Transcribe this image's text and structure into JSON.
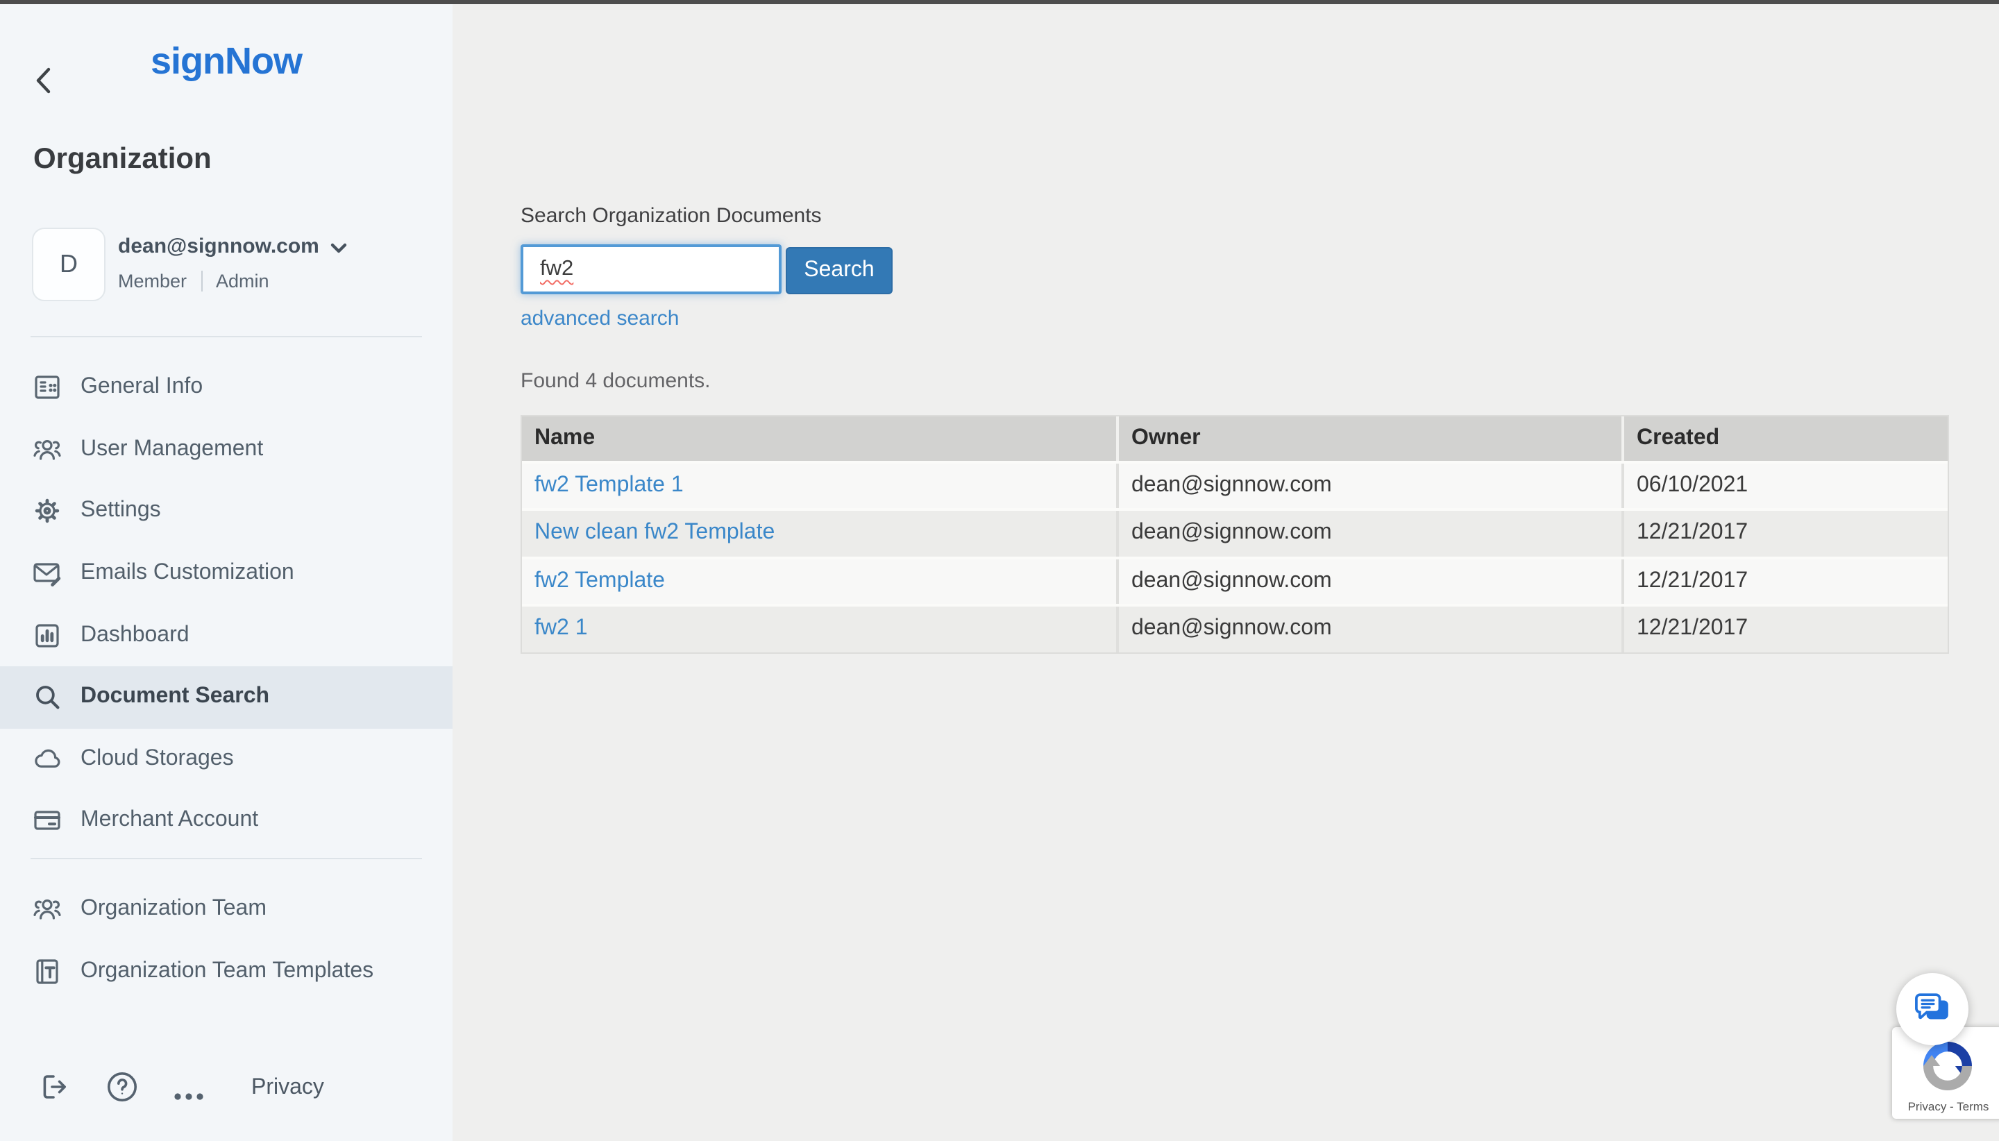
{
  "colors": {
    "accent_blue": "#2574d4",
    "link_blue": "#3a87c9",
    "button_blue": "#3379b5",
    "sidebar_bg": "#f3f6f9",
    "main_bg": "#efefee",
    "active_item_bg": "#e2e8ee",
    "slate_icon": "#5a6671",
    "table_header_bg": "#d2d2d0",
    "row_light": "#f8f8f7",
    "row_dark": "#ececea",
    "topbar": "#4d4d4d",
    "spellcheck_red": "#f26b63"
  },
  "sidebar": {
    "logo": "signNow",
    "back_icon": "chevron-left-icon",
    "section_title": "Organization",
    "profile": {
      "avatar_letter": "D",
      "email": "dean@signnow.com",
      "dropdown_icon": "chevron-down-icon",
      "roles": [
        "Member",
        "Admin"
      ]
    },
    "nav_primary": [
      {
        "label": "General Info",
        "icon": "building-icon",
        "active": false
      },
      {
        "label": "User Management",
        "icon": "users-icon",
        "active": false
      },
      {
        "label": "Settings",
        "icon": "gear-icon",
        "active": false
      },
      {
        "label": "Emails Customization",
        "icon": "envelope-brush-icon",
        "active": false
      },
      {
        "label": "Dashboard",
        "icon": "bar-chart-icon",
        "active": false
      },
      {
        "label": "Document Search",
        "icon": "search-icon",
        "active": true
      },
      {
        "label": "Cloud Storages",
        "icon": "cloud-icon",
        "active": false
      },
      {
        "label": "Merchant Account",
        "icon": "credit-card-icon",
        "active": false
      }
    ],
    "nav_secondary": [
      {
        "label": "Organization Team",
        "icon": "users-icon",
        "active": false
      },
      {
        "label": "Organization Team Templates",
        "icon": "template-icon",
        "active": false
      }
    ],
    "footer": {
      "logout_icon": "logout-icon",
      "help_icon": "question-circle-icon",
      "more_icon": "ellipsis-icon",
      "privacy_label": "Privacy"
    }
  },
  "main": {
    "search_label": "Search Organization Documents",
    "search_value": "fw2",
    "search_button_label": "Search",
    "advanced_search_label": "advanced search",
    "results_summary": "Found 4 documents.",
    "table": {
      "columns": [
        "Name",
        "Owner",
        "Created"
      ],
      "rows": [
        {
          "name": "fw2 Template 1",
          "owner": "dean@signnow.com",
          "created": "06/10/2021"
        },
        {
          "name": "New clean fw2 Template",
          "owner": "dean@signnow.com",
          "created": "12/21/2017"
        },
        {
          "name": "fw2 Template",
          "owner": "dean@signnow.com",
          "created": "12/21/2017"
        },
        {
          "name": "fw2 1",
          "owner": "dean@signnow.com",
          "created": "12/21/2017"
        }
      ]
    }
  },
  "widgets": {
    "chat_icon": "chat-bubbles-icon",
    "recaptcha": {
      "logo": "recaptcha-icon",
      "privacy_terms": "Privacy - Terms"
    }
  }
}
